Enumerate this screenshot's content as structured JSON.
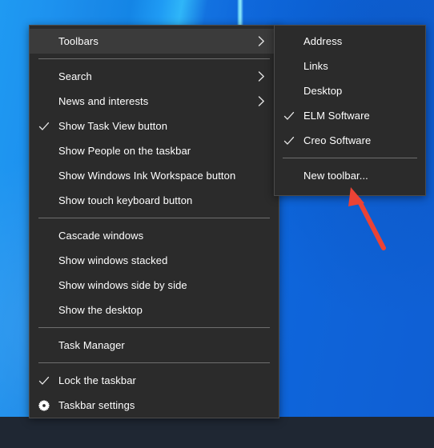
{
  "desktop": {
    "wallpaper_color_light": "#1f9af2",
    "wallpaper_color_dark": "#0f5fd4",
    "taskbar_color": "#1f2733"
  },
  "context_menu": {
    "name": "taskbar-context-menu",
    "background_color": "#2b2b2b",
    "border_color": "#4b4b4b",
    "text_color": "#ffffff",
    "highlight_color": "#3b3b3b",
    "groups": [
      {
        "items": [
          {
            "label": "Toolbars",
            "icon": "none",
            "submenu_arrow": true,
            "checked": false,
            "highlighted": true
          }
        ]
      },
      {
        "items": [
          {
            "label": "Search",
            "icon": "none",
            "submenu_arrow": true,
            "checked": false,
            "highlighted": false
          },
          {
            "label": "News and interests",
            "icon": "none",
            "submenu_arrow": true,
            "checked": false,
            "highlighted": false
          },
          {
            "label": "Show Task View button",
            "icon": "check",
            "submenu_arrow": false,
            "checked": true,
            "highlighted": false
          },
          {
            "label": "Show People on the taskbar",
            "icon": "none",
            "submenu_arrow": false,
            "checked": false,
            "highlighted": false
          },
          {
            "label": "Show Windows Ink Workspace button",
            "icon": "none",
            "submenu_arrow": false,
            "checked": false,
            "highlighted": false
          },
          {
            "label": "Show touch keyboard button",
            "icon": "none",
            "submenu_arrow": false,
            "checked": false,
            "highlighted": false
          }
        ]
      },
      {
        "items": [
          {
            "label": "Cascade windows",
            "icon": "none",
            "submenu_arrow": false,
            "checked": false,
            "highlighted": false
          },
          {
            "label": "Show windows stacked",
            "icon": "none",
            "submenu_arrow": false,
            "checked": false,
            "highlighted": false
          },
          {
            "label": "Show windows side by side",
            "icon": "none",
            "submenu_arrow": false,
            "checked": false,
            "highlighted": false
          },
          {
            "label": "Show the desktop",
            "icon": "none",
            "submenu_arrow": false,
            "checked": false,
            "highlighted": false
          }
        ]
      },
      {
        "items": [
          {
            "label": "Task Manager",
            "icon": "none",
            "submenu_arrow": false,
            "checked": false,
            "highlighted": false
          }
        ]
      },
      {
        "items": [
          {
            "label": "Lock the taskbar",
            "icon": "check",
            "submenu_arrow": false,
            "checked": true,
            "highlighted": false
          },
          {
            "label": "Taskbar settings",
            "icon": "gear",
            "submenu_arrow": false,
            "checked": false,
            "highlighted": false
          }
        ]
      }
    ]
  },
  "toolbars_submenu": {
    "name": "toolbars-submenu",
    "parent_item": "Toolbars",
    "groups": [
      {
        "items": [
          {
            "label": "Address",
            "icon": "none",
            "checked": false
          },
          {
            "label": "Links",
            "icon": "none",
            "checked": false
          },
          {
            "label": "Desktop",
            "icon": "none",
            "checked": false
          },
          {
            "label": "ELM Software",
            "icon": "check",
            "checked": true
          },
          {
            "label": "Creo Software",
            "icon": "check",
            "checked": true
          }
        ]
      },
      {
        "items": [
          {
            "label": "New toolbar...",
            "icon": "none",
            "checked": false
          }
        ]
      }
    ]
  },
  "annotation": {
    "type": "arrow",
    "color": "#ea4335",
    "points_to": "New toolbar..."
  }
}
